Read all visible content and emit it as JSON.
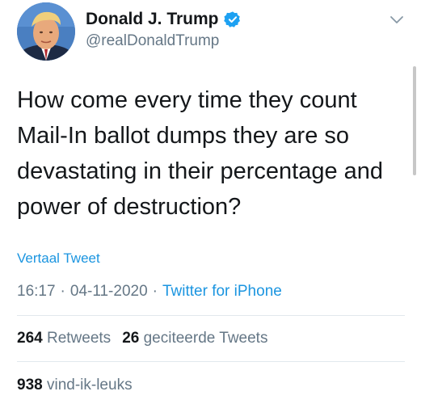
{
  "author": {
    "name": "Donald J. Trump",
    "handle": "@realDonaldTrump",
    "verified": true
  },
  "tweet": {
    "text": "How come every time they count Mail-In ballot dumps they are so devastating in their percentage and power of destruction?",
    "translate_label": "Vertaal Tweet",
    "time": "16:17",
    "date": "04-11-2020",
    "separator": "·",
    "source": "Twitter for iPhone"
  },
  "stats": {
    "retweets_count": "264",
    "retweets_label": "Retweets",
    "quotes_count": "26",
    "quotes_label": "geciteerde Tweets",
    "likes_count": "938",
    "likes_label": "vind-ik-leuks"
  },
  "colors": {
    "link": "#1b95e0",
    "secondary_text": "#657786",
    "primary_text": "#14171a",
    "verified_badge": "#1da1f2",
    "divider": "#e1e8ed"
  },
  "icons": {
    "verified": "verified-badge-icon",
    "menu": "chevron-down-icon"
  }
}
